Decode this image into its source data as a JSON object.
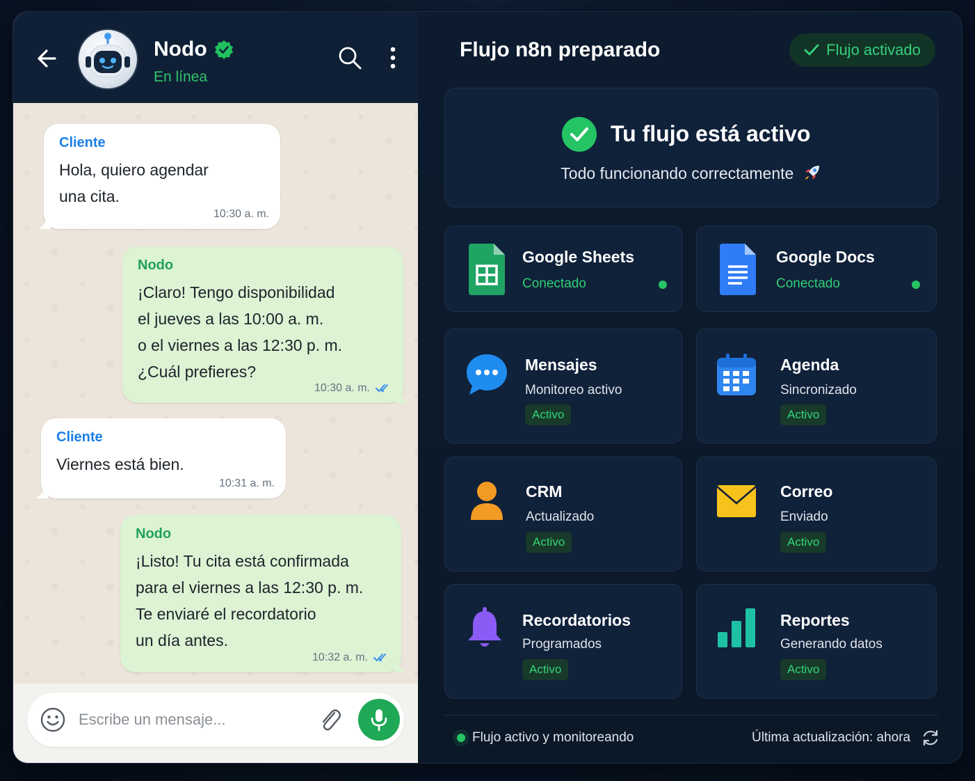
{
  "chat": {
    "contact_name": "Nodo",
    "contact_status": "En línea",
    "messages": [
      {
        "sender": "Cliente",
        "lines": [
          "Hola, quiero agendar",
          "una cita."
        ],
        "time": "10:30 a. m."
      },
      {
        "sender": "Nodo",
        "lines": [
          "¡Claro! Tengo disponibilidad",
          "el jueves a las 10:00 a. m.",
          "o el viernes a las 12:30 p. m.",
          "¿Cuál prefieres?"
        ],
        "time": "10:30 a. m."
      },
      {
        "sender": "Cliente",
        "lines": [
          "Viernes está bien."
        ],
        "time": "10:31 a. m."
      },
      {
        "sender": "Nodo",
        "lines": [
          "¡Listo! Tu cita está confirmada",
          "para el viernes a las 12:30 p. m.",
          "Te enviaré el recordatorio",
          "un día antes."
        ],
        "time": "10:32 a. m."
      }
    ],
    "input_placeholder": "Escribe un mensaje..."
  },
  "flow": {
    "title": "Flujo n8n preparado",
    "badge": "Flujo activado",
    "hero_title": "Tu flujo está activo",
    "hero_subtitle": "Todo funcionando correctamente",
    "integrations": [
      {
        "title": "Google Sheets",
        "status": "Conectado",
        "icon": "google-sheets-icon"
      },
      {
        "title": "Google Docs",
        "status": "Conectado",
        "icon": "google-docs-icon"
      }
    ],
    "modules": [
      {
        "title": "Mensajes",
        "subtitle": "Monitoreo activo",
        "badge": "Activo",
        "icon": "chat-bubble-icon"
      },
      {
        "title": "Agenda",
        "subtitle": "Sincronizado",
        "badge": "Activo",
        "icon": "calendar-icon"
      },
      {
        "title": "CRM",
        "subtitle": "Actualizado",
        "badge": "Activo",
        "icon": "user-icon"
      },
      {
        "title": "Correo",
        "subtitle": "Enviado",
        "badge": "Activo",
        "icon": "mail-icon"
      },
      {
        "title": "Recordatorios",
        "subtitle": "Programados",
        "badge": "Activo",
        "icon": "bell-icon"
      },
      {
        "title": "Reportes",
        "subtitle": "Generando datos",
        "badge": "Activo",
        "icon": "bar-chart-icon"
      }
    ],
    "footer_status": "Flujo activo y monitoreando",
    "footer_updated": "Última actualización: ahora"
  },
  "colors": {
    "chat_header": "#0f2036",
    "accent_green": "#27c565",
    "client_sender": "#1a7fe6",
    "bot_sender": "#21a158",
    "panel_bg": "#0c1b2e",
    "card_bg": "#10213a"
  }
}
